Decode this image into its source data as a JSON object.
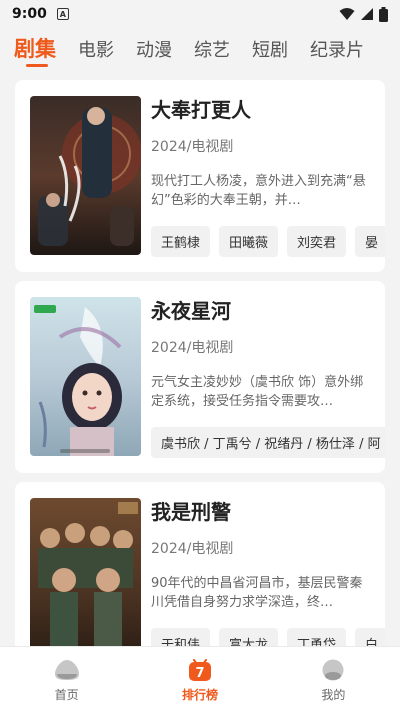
{
  "status_bar": {
    "time": "9:00",
    "notification_letter": "A"
  },
  "tabs": [
    {
      "label": "剧集",
      "active": true
    },
    {
      "label": "电影",
      "active": false
    },
    {
      "label": "动漫",
      "active": false
    },
    {
      "label": "综艺",
      "active": false
    },
    {
      "label": "短剧",
      "active": false
    },
    {
      "label": "纪录片",
      "active": false
    }
  ],
  "shows": [
    {
      "title": "大奉打更人",
      "meta": "2024/电视剧",
      "description": "现代打工人杨凌，意外进入到充满“悬幻”色彩的大奉王朝，并…",
      "cast": [
        "王鹤棣",
        "田曦薇",
        "刘奕君",
        "晏"
      ]
    },
    {
      "title": "永夜星河",
      "meta": "2024/电视剧",
      "description": "元气女主凌妙妙（虞书欣 饰）意外绑定系统，接受任务指令需要攻…",
      "cast": [
        "虞书欣 / 丁禹兮 / 祝绪丹 / 杨仕泽 / 阿"
      ]
    },
    {
      "title": "我是刑警",
      "meta": "2024/电视剧",
      "description": "90年代的中昌省河昌市，基层民警秦川凭借自身努力求学深造，终…",
      "cast": [
        "于和伟",
        "富大龙",
        "丁勇岱",
        "白"
      ]
    }
  ],
  "bottom_nav": [
    {
      "label": "首页",
      "icon": "home-blob-icon",
      "active": false
    },
    {
      "label": "排行榜",
      "icon": "ranking-7-icon",
      "active": true,
      "badge": "7"
    },
    {
      "label": "我的",
      "icon": "profile-blob-icon",
      "active": false
    }
  ],
  "colors": {
    "accent": "#ef5a1c",
    "background": "#f3f3f3",
    "card": "#ffffff"
  }
}
